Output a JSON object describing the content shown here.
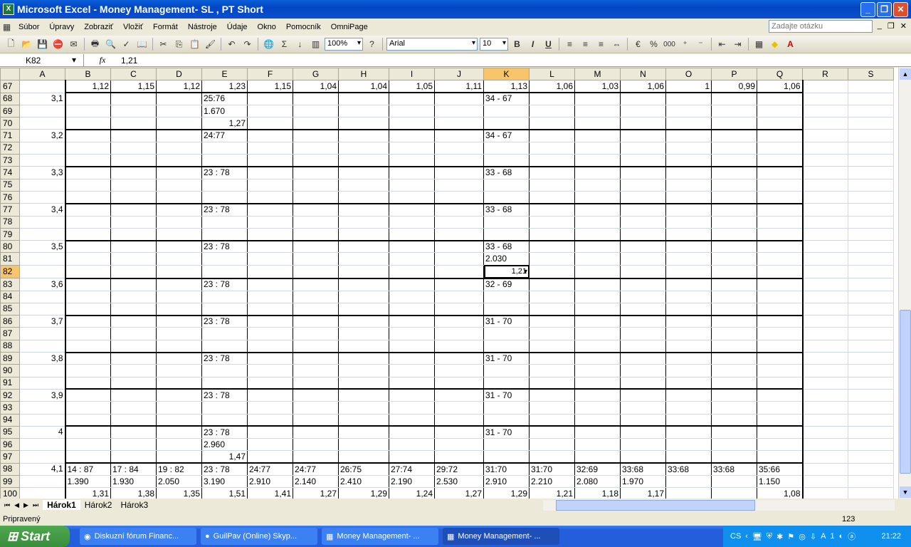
{
  "window": {
    "title": "Microsoft Excel - Money Management- SL  , PT Short"
  },
  "menu": [
    "Súbor",
    "Úpravy",
    "Zobraziť",
    "Vložiť",
    "Formát",
    "Nástroje",
    "Údaje",
    "Okno",
    "Pomocník",
    "OmniPage"
  ],
  "ask_placeholder": "Zadajte otázku",
  "toolbar": {
    "zoom": "100%",
    "font": "Arial",
    "size": "10",
    "bold": "B",
    "italic": "I",
    "underline": "U",
    "percent": "%",
    "thousands": "000"
  },
  "formula": {
    "cell": "K82",
    "fx": "fx",
    "value": "1,21"
  },
  "columns": [
    "A",
    "B",
    "C",
    "D",
    "E",
    "F",
    "G",
    "H",
    "I",
    "J",
    "K",
    "L",
    "M",
    "N",
    "O",
    "P",
    "Q",
    "R",
    "S"
  ],
  "active_col": "K",
  "active_row": 82,
  "rows": [
    {
      "n": 67,
      "c": {
        "B": "1,12",
        "C": "1,15",
        "D": "1,12",
        "E": "1,23",
        "F": "1,15",
        "G": "1,04",
        "H": "1,04",
        "I": "1,05",
        "J": "1,11",
        "K": "1,13",
        "L": "1,06",
        "M": "1,03",
        "N": "1,06",
        "O": "1",
        "P": "0,99",
        "Q": "1,06"
      }
    },
    {
      "n": 68,
      "c": {
        "A": "3,1",
        "E": "25:76",
        "K": "34 - 67"
      }
    },
    {
      "n": 69,
      "c": {
        "E": "1.670"
      }
    },
    {
      "n": 70,
      "c": {
        "E": "1,27"
      }
    },
    {
      "n": 71,
      "c": {
        "A": "3,2",
        "E": "24:77",
        "K": "34 - 67"
      }
    },
    {
      "n": 72,
      "c": {}
    },
    {
      "n": 73,
      "c": {}
    },
    {
      "n": 74,
      "c": {
        "A": "3,3",
        "E": " 23 : 78",
        "K": "33 - 68"
      }
    },
    {
      "n": 75,
      "c": {}
    },
    {
      "n": 76,
      "c": {}
    },
    {
      "n": 77,
      "c": {
        "A": "3,4",
        "E": " 23 : 78",
        "K": "33 - 68"
      }
    },
    {
      "n": 78,
      "c": {}
    },
    {
      "n": 79,
      "c": {}
    },
    {
      "n": 80,
      "c": {
        "A": "3,5",
        "E": " 23 : 78",
        "K": "33 - 68"
      }
    },
    {
      "n": 81,
      "c": {
        "K": "2.030"
      }
    },
    {
      "n": 82,
      "c": {
        "K": "1,21"
      }
    },
    {
      "n": 83,
      "c": {
        "A": "3,6",
        "E": " 23 : 78",
        "K": "32 - 69"
      }
    },
    {
      "n": 84,
      "c": {}
    },
    {
      "n": 85,
      "c": {}
    },
    {
      "n": 86,
      "c": {
        "A": "3,7",
        "E": " 23 : 78",
        "K": "31 - 70"
      }
    },
    {
      "n": 87,
      "c": {}
    },
    {
      "n": 88,
      "c": {}
    },
    {
      "n": 89,
      "c": {
        "A": "3,8",
        "E": " 23 : 78",
        "K": "31 - 70"
      }
    },
    {
      "n": 90,
      "c": {}
    },
    {
      "n": 91,
      "c": {}
    },
    {
      "n": 92,
      "c": {
        "A": "3,9",
        "E": " 23 : 78",
        "K": "31 - 70"
      }
    },
    {
      "n": 93,
      "c": {}
    },
    {
      "n": 94,
      "c": {}
    },
    {
      "n": 95,
      "c": {
        "A": "4",
        "E": " 23 : 78",
        "K": "31 - 70"
      }
    },
    {
      "n": 96,
      "c": {
        "E": "2.960"
      }
    },
    {
      "n": 97,
      "c": {
        "E": "1,47"
      }
    },
    {
      "n": 98,
      "c": {
        "A": "4,1",
        "B": " 14 : 87",
        "C": " 17 : 84",
        "D": " 19 : 82",
        "E": " 23 : 78",
        "F": "24:77",
        "G": "24:77",
        "H": "26:75",
        "I": "27:74",
        "J": "29:72",
        "K": "31:70",
        "L": "31:70",
        "M": "32:69",
        "N": "33:68",
        "O": "33:68",
        "P": "33:68",
        "Q": "35:66"
      }
    },
    {
      "n": 99,
      "c": {
        "B": "1.390",
        "C": "1.930",
        "D": "2.050",
        "E": "3.190",
        "F": "2.910",
        "G": "2.140",
        "H": "2.410",
        "I": "2.190",
        "J": "2.530",
        "K": "2.910",
        "L": "2.210",
        "M": "2.080",
        "N": "1.970",
        "Q": "1.150"
      }
    },
    {
      "n": 100,
      "c": {
        "B": "1,31",
        "C": "1,38",
        "D": "1,35",
        "E": "1,51",
        "F": "1,41",
        "G": "1,27",
        "H": "1,29",
        "I": "1,24",
        "J": "1,27",
        "K": "1,29",
        "L": "1,21",
        "M": "1,18",
        "N": "1,17",
        "Q": "1,08"
      }
    }
  ],
  "sheets": [
    "Hárok1",
    "Hárok2",
    "Hárok3"
  ],
  "status": {
    "ready": "Pripravený",
    "num": "123"
  },
  "taskbar": {
    "start": "Start",
    "tasks": [
      "Diskuzní fórum Financ...",
      "GuilPav (Online) Skyp...",
      "Money Management- ...",
      "Money Management- ..."
    ],
    "lang": "CS",
    "clock": "21:22"
  }
}
